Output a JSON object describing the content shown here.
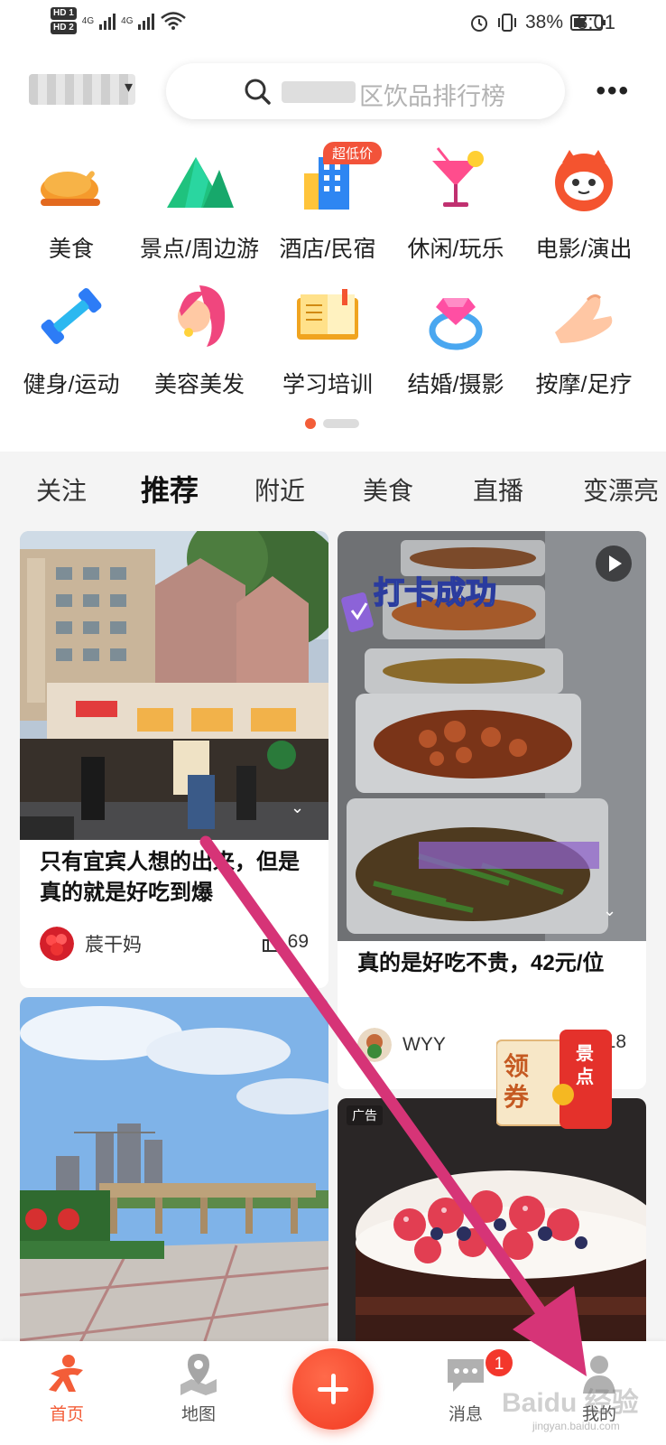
{
  "status_bar": {
    "hd1": "HD 1",
    "hd2": "HD 2",
    "net1": "4G",
    "net2": "4G",
    "battery": "38%",
    "time": "8:01"
  },
  "header": {
    "search_placeholder": "区饮品排行榜",
    "more_label": "•••"
  },
  "categories": [
    {
      "label": "美食",
      "icon": "roast-chicken-icon"
    },
    {
      "label": "景点/周边游",
      "icon": "mountain-icon"
    },
    {
      "label": "酒店/民宿",
      "icon": "hotel-building-icon"
    },
    {
      "label": "休闲/玩乐",
      "icon": "cocktail-icon"
    },
    {
      "label": "电影/演出",
      "icon": "cat-face-icon"
    },
    {
      "label": "健身/运动",
      "icon": "dumbbell-icon"
    },
    {
      "label": "美容美发",
      "icon": "woman-hair-icon"
    },
    {
      "label": "学习培训",
      "icon": "open-book-icon"
    },
    {
      "label": "结婚/摄影",
      "icon": "diamond-ring-icon"
    },
    {
      "label": "按摩/足疗",
      "icon": "massage-hand-icon"
    }
  ],
  "promo_badge": "超低价",
  "pager": {
    "current": 1,
    "total": 2
  },
  "tabs": [
    "关注",
    "推荐",
    "附近",
    "美食",
    "直播",
    "变漂亮"
  ],
  "active_tab": "推荐",
  "feed": {
    "card1": {
      "title": "只有宜宾人想的出来，但是真的就是好吃到爆",
      "user": "莀干妈",
      "likes": "69"
    },
    "card2": {
      "title": "真的是好吃不贵，42元/位",
      "user": "WYY",
      "likes": "18",
      "overlay_text": "打卡成功"
    },
    "card4": {
      "ad_label": "广告"
    },
    "coupon": {
      "main": "领券",
      "side": "景点"
    }
  },
  "bottom_nav": {
    "home": "首页",
    "map": "地图",
    "messages": "消息",
    "messages_badge": "1",
    "mine": "我的"
  },
  "watermark": {
    "text": "Baidu 经验",
    "sub": "jingyan.baidu.com"
  },
  "colors": {
    "accent": "#f35d38",
    "annotation_arrow": "#d63477"
  }
}
